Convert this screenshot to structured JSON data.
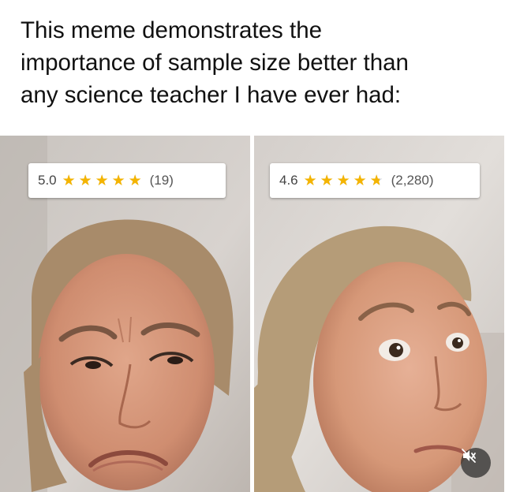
{
  "caption": {
    "lines": [
      "This meme demonstrates the",
      "importance of sample size better than",
      "any science teacher I have ever had:"
    ]
  },
  "panels": [
    {
      "rating": "5.0",
      "stars": 5.0,
      "count": "(19)",
      "expression": "frowning skeptical face"
    },
    {
      "rating": "4.6",
      "stars": 4.6,
      "count": "(2,280)",
      "expression": "impressed raised-eyebrow face"
    }
  ],
  "colors": {
    "star": "#f4b400",
    "star_empty": "#d4d4d4",
    "card": "#ffffff",
    "caption": "#111111"
  },
  "icons": {
    "mute": "speaker-muted-icon"
  }
}
